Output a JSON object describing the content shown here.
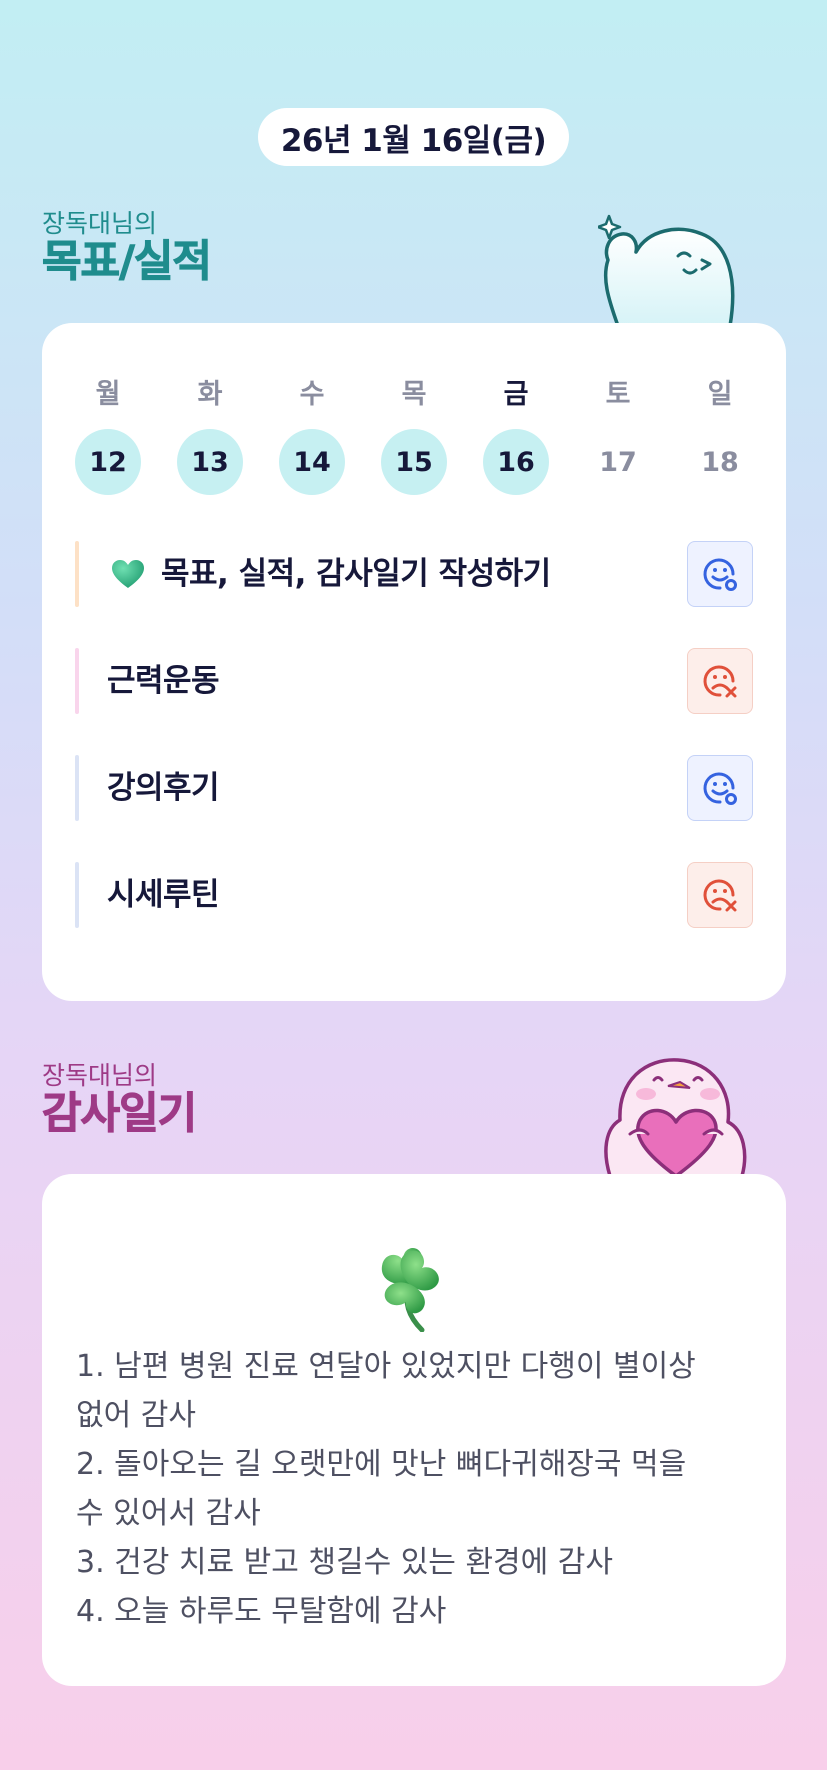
{
  "header": {
    "date": "26년 1월 16일(금)"
  },
  "goals_section": {
    "subtitle": "장독대님의",
    "title": "목표/실적"
  },
  "week": [
    {
      "name": "월",
      "num": "12",
      "done": true,
      "today": false
    },
    {
      "name": "화",
      "num": "13",
      "done": true,
      "today": false
    },
    {
      "name": "수",
      "num": "14",
      "done": true,
      "today": false
    },
    {
      "name": "목",
      "num": "15",
      "done": true,
      "today": false
    },
    {
      "name": "금",
      "num": "16",
      "done": true,
      "today": true
    },
    {
      "name": "토",
      "num": "17",
      "done": false,
      "today": false
    },
    {
      "name": "일",
      "num": "18",
      "done": false,
      "today": false
    }
  ],
  "tasks": [
    {
      "label": "목표, 실적, 감사일기 작성하기",
      "icon": "green-heart-icon",
      "status": "good",
      "bar_color": "#fde1c6"
    },
    {
      "label": "근력운동",
      "status": "bad",
      "bar_color": "#f9d5ec"
    },
    {
      "label": "강의후기",
      "status": "good",
      "bar_color": "#dbe3f5"
    },
    {
      "label": "시세루틴",
      "status": "bad",
      "bar_color": "#dbe3f5"
    }
  ],
  "diary_section": {
    "subtitle": "장독대님의",
    "title": "감사일기"
  },
  "diary": {
    "icon": "clover-icon",
    "lines": [
      "1. 남편 병원 진료 연달아 있었지만 다행이 별이상",
      "없어 감사",
      "2. 돌아오는 길 오랫만에 맛난 뼈다귀해장국 먹을",
      "수 있어서 감사",
      "3. 건강 치료 받고 챙길수 있는 환경에 감사",
      "4. 오늘 하루도 무탈함에 감사"
    ]
  },
  "colors": {
    "goal_title": "#1f8c8d",
    "diary_title": "#9e3a86",
    "done_circle": "#c6f0f2",
    "status_good": "#3563e0",
    "status_bad": "#e0503a"
  }
}
